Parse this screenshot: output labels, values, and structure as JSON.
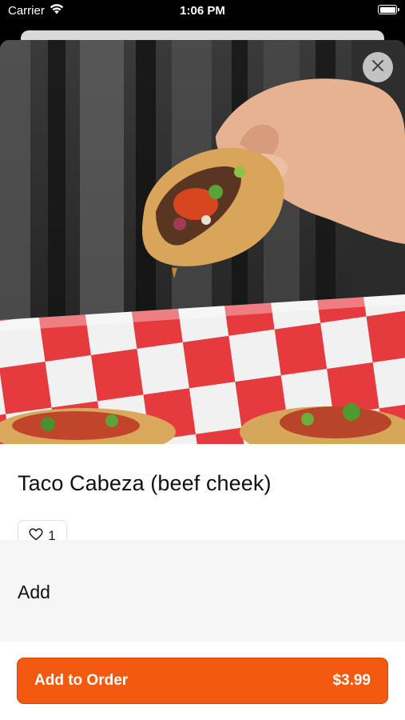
{
  "status_bar": {
    "carrier": "Carrier",
    "time": "1:06 PM",
    "icons": [
      "wifi-icon",
      "battery-icon"
    ]
  },
  "item": {
    "image_alt": "Hand holding a taco over a red and white checkered paper tray of tacos",
    "title": "Taco Cabeza (beef cheek)",
    "like_count": "1",
    "like_icon": "heart-icon"
  },
  "close_icon": "close-icon",
  "section": {
    "heading": "Add"
  },
  "order_button": {
    "label": "Add to Order",
    "price": "$3.99"
  },
  "colors": {
    "accent": "#f35a10",
    "section_background": "#f6f6f6"
  }
}
